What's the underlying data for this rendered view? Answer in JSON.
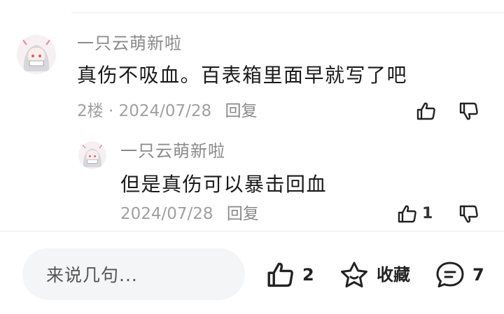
{
  "comments": [
    {
      "username": "一只云萌新啦",
      "content": "真伤不吸血。百表箱里面早就写了吧",
      "floor": "2楼",
      "separator": "·",
      "date": "2024/07/28",
      "reply_label": "回复",
      "like_count": ""
    },
    {
      "username": "一只云萌新啦",
      "content": "但是真伤可以暴击回血",
      "date": "2024/07/28",
      "reply_label": "回复",
      "like_count": "1"
    }
  ],
  "bottom_bar": {
    "input_placeholder": "来说几句...",
    "like_count": "2",
    "favorite_label": "收藏",
    "comment_count": "7"
  },
  "colors": {
    "meta_text": "#a0a0a0",
    "name_text": "#8a8a8a",
    "input_bg": "#f4f5f7"
  },
  "icons": [
    "avatar-anime-girl",
    "thumbs-up-icon",
    "thumbs-down-icon",
    "star-icon",
    "comment-bubble-icon"
  ]
}
